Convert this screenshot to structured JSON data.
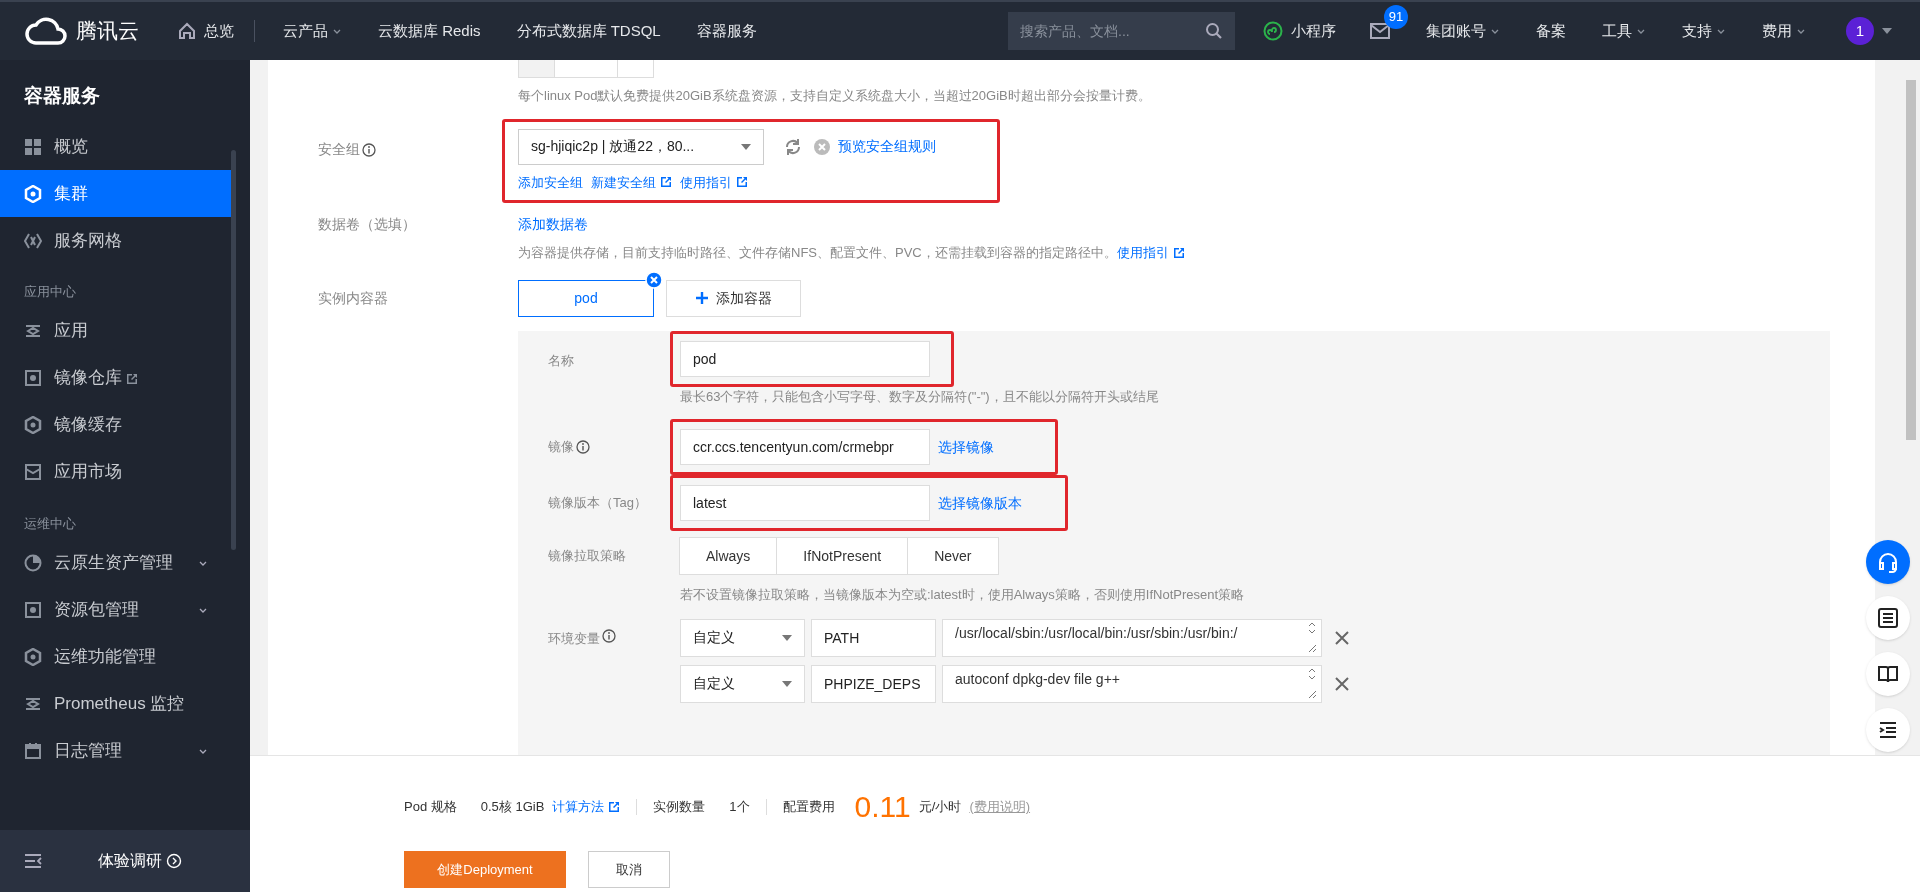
{
  "topbar": {
    "brand": "腾讯云",
    "home": "总览",
    "nav": [
      {
        "label": "云产品",
        "dropdown": true
      },
      {
        "label": "云数据库 Redis",
        "dropdown": false
      },
      {
        "label": "分布式数据库 TDSQL",
        "dropdown": false
      },
      {
        "label": "容器服务",
        "dropdown": false
      }
    ],
    "search": {
      "placeholder": "搜索产品、文档..."
    },
    "mini_program": "小程序",
    "mail_badge": "91",
    "right_menu": [
      {
        "label": "集团账号",
        "dropdown": true
      },
      {
        "label": "备案",
        "dropdown": false
      },
      {
        "label": "工具",
        "dropdown": true
      },
      {
        "label": "支持",
        "dropdown": true
      },
      {
        "label": "费用",
        "dropdown": true
      }
    ],
    "avatar": "1"
  },
  "sidebar": {
    "title": "容器服务",
    "items": [
      {
        "kind": "item",
        "label": "概览",
        "selected": false,
        "external": false,
        "expandable": false
      },
      {
        "kind": "item",
        "label": "集群",
        "selected": true,
        "external": false,
        "expandable": false
      },
      {
        "kind": "item",
        "label": "服务网格",
        "selected": false,
        "external": false,
        "expandable": false
      },
      {
        "kind": "section",
        "label": "应用中心"
      },
      {
        "kind": "item",
        "label": "应用",
        "selected": false,
        "external": false,
        "expandable": false
      },
      {
        "kind": "item",
        "label": "镜像仓库",
        "selected": false,
        "external": true,
        "expandable": false
      },
      {
        "kind": "item",
        "label": "镜像缓存",
        "selected": false,
        "external": false,
        "expandable": false
      },
      {
        "kind": "item",
        "label": "应用市场",
        "selected": false,
        "external": false,
        "expandable": false
      },
      {
        "kind": "section",
        "label": "运维中心"
      },
      {
        "kind": "item",
        "label": "云原生资产管理",
        "selected": false,
        "external": false,
        "expandable": true
      },
      {
        "kind": "item",
        "label": "资源包管理",
        "selected": false,
        "external": false,
        "expandable": true
      },
      {
        "kind": "item",
        "label": "运维功能管理",
        "selected": false,
        "external": false,
        "expandable": false
      },
      {
        "kind": "item",
        "label": "Prometheus 监控",
        "selected": false,
        "external": false,
        "expandable": false
      },
      {
        "kind": "item",
        "label": "日志管理",
        "selected": false,
        "external": false,
        "expandable": true
      }
    ],
    "survey": "体验调研"
  },
  "form": {
    "disk_hint": "每个linux Pod默认免费提供20GiB系统盘资源，支持自定义系统盘大小，当超过20GiB时超出部分会按量计费。",
    "security_group": {
      "label": "安全组",
      "highlighted": true,
      "value": "sg-hjiqic2p | 放通22，80...",
      "preview_link": "预览安全组规则",
      "links": [
        {
          "label": "添加安全组",
          "external": false
        },
        {
          "label": "新建安全组",
          "external": true
        },
        {
          "label": "使用指引",
          "external": true
        }
      ]
    },
    "volumes": {
      "label": "数据卷（选填）",
      "add_link": "添加数据卷",
      "hint": "为容器提供存储，目前支持临时路径、文件存储NFS、配置文件、PVC，还需挂载到容器的指定路径中。",
      "guide_link": "使用指引"
    },
    "containers": {
      "label": "实例内容器",
      "tabs": [
        {
          "label": "pod",
          "selected": true
        }
      ],
      "add_button": "添加容器"
    },
    "container": {
      "name": {
        "label": "名称",
        "value": "pod",
        "highlighted": true,
        "hint": "最长63个字符，只能包含小写字母、数字及分隔符(\"-\")，且不能以分隔符开头或结尾"
      },
      "image": {
        "label": "镜像",
        "value": "ccr.ccs.tencentyun.com/crmebpr",
        "link": "选择镜像",
        "highlighted": true
      },
      "tag": {
        "label": "镜像版本（Tag）",
        "value": "latest",
        "link": "选择镜像版本",
        "highlighted": true
      },
      "pull_policy": {
        "label": "镜像拉取策略",
        "options": [
          {
            "label": "Always",
            "selected": false
          },
          {
            "label": "IfNotPresent",
            "selected": false
          },
          {
            "label": "Never",
            "selected": false
          }
        ],
        "hint": "若不设置镜像拉取策略，当镜像版本为空或:latest时，使用Always策略，否则使用IfNotPresent策略"
      },
      "env": {
        "label": "环境变量",
        "rows": [
          {
            "type": "自定义",
            "key": "PATH",
            "value": "/usr/local/sbin:/usr/local/bin:/usr/sbin:/usr/bin:/"
          },
          {
            "type": "自定义",
            "key": "PHPIZE_DEPS",
            "value": "autoconf dpkg-dev file g++"
          }
        ]
      }
    }
  },
  "footer": {
    "spec_label": "Pod 规格",
    "spec_value": "0.5核 1GiB",
    "calc_link": "计算方法",
    "count_label": "实例数量",
    "count_value": "1个",
    "fee_label": "配置费用",
    "price": "0.11",
    "unit": "元/小时",
    "fee_link": "(费用说明)",
    "create_button": "创建Deployment",
    "cancel_button": "取消"
  }
}
